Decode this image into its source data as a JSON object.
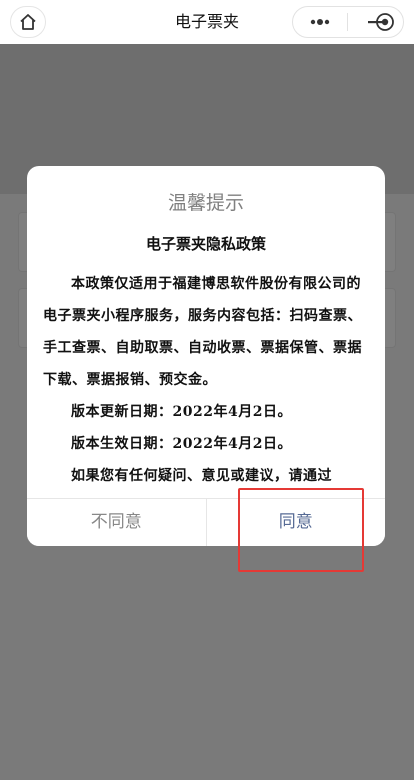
{
  "navbar": {
    "title": "电子票夹",
    "home_icon": "home-icon",
    "more_icon": "more-dots-icon",
    "minimize_icon": "minimize-icon",
    "close_icon": "target-close-icon"
  },
  "modal": {
    "title": "温馨提示",
    "heading": "电子票夹隐私政策",
    "paragraphs": [
      "本政策仅适用于福建博思软件股份有限公司的电子票夹小程序服务，服务内容包括：扫码查票、手工查票、自助取票、自动收票、票据保管、票据下载、票据报销、预交金。",
      "版本更新日期：2022年4月2日。",
      "版本生效日期：2022年4月2日。",
      "如果您有任何疑问、意见或建议，请通过"
    ],
    "disagree_label": "不同意",
    "agree_label": "同意"
  },
  "colors": {
    "agree": "#576b95",
    "disagree": "#888888",
    "highlight": "#e53935",
    "mask": "rgba(0,0,0,0.5)"
  }
}
